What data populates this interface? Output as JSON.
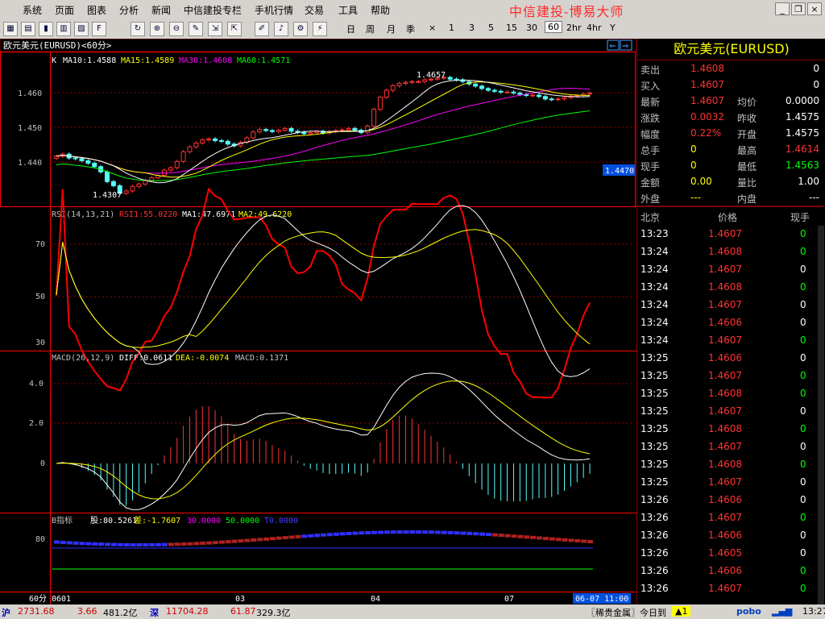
{
  "menu": [
    "系统",
    "页面",
    "图表",
    "分析",
    "新闻",
    "中信建投专栏",
    "手机行情",
    "交易",
    "工具",
    "帮助"
  ],
  "brand": "中信建投-博易大师",
  "periods": [
    "日",
    "周",
    "月",
    "季",
    "×",
    "1",
    "3",
    "5",
    "15",
    "30",
    "60",
    "2hr",
    "4hr",
    "Y"
  ],
  "selected_period": "60",
  "chart_title": "欧元美元(EURUSD)<60分>",
  "colors": {
    "up": "#ff3333",
    "down": "#54fcfc",
    "ma10": "#ffffff",
    "ma15": "#ffff00",
    "ma30": "#ff00ff",
    "ma60": "#00ff00",
    "grid": "#8b0000",
    "axis": "#ff0000"
  },
  "kpanel": {
    "label_k": "K",
    "ma10": "MA10:1.4588",
    "ma15": "MA15:1.4589",
    "ma30": "MA30:1.4608",
    "ma60": "MA60:1.4571",
    "ticks": [
      "1.460",
      "1.450",
      "1.440"
    ],
    "high_annot": "1.4657",
    "low_annot": "1.4307",
    "price_tag": "1.4470"
  },
  "rsi": {
    "label": "RSI(14,13,21)",
    "rsi1": "RSI1:55.0220",
    "ma1": "MA1:47.6971",
    "ma2": "MA2:49.6220",
    "ticks": [
      "70",
      "50",
      "30"
    ]
  },
  "macd": {
    "label": "MACD(26,12,9)",
    "diff": "DIFF:0.0611",
    "dea": "DEA:-0.0074",
    "macd": "MACD:0.1371",
    "ticks": [
      "4.0",
      "2.0",
      "0"
    ]
  },
  "b": {
    "label": "B指标",
    "gu": "股:80.5261",
    "cha": "差:-1.7607",
    "v30": "30.0000",
    "v50": "50.0000",
    "t0": "T0.0000",
    "ticks": [
      "80"
    ]
  },
  "xaxis": {
    "period_label": "60分",
    "labels": [
      "0601",
      "03",
      "04",
      "07"
    ],
    "cursor": "06-07 11:00"
  },
  "chart_data": {
    "type": "line",
    "x": [
      "0601",
      "03",
      "04",
      "07"
    ],
    "series": [
      {
        "name": "MA10",
        "values": [
          1.4588
        ]
      },
      {
        "name": "MA15",
        "values": [
          1.4589
        ]
      },
      {
        "name": "MA30",
        "values": [
          1.4608
        ]
      },
      {
        "name": "MA60",
        "values": [
          1.4571
        ]
      }
    ],
    "ylim": [
      1.429,
      1.468
    ],
    "candles_close": [
      1.4425,
      1.4431,
      1.442,
      1.4418,
      1.4412,
      1.4405,
      1.4395,
      1.438,
      1.4352,
      1.434,
      1.4318,
      1.4325,
      1.4338,
      1.4345,
      1.4356,
      1.4363,
      1.437,
      1.4385,
      1.4392,
      1.441,
      1.4438,
      1.4452,
      1.4463,
      1.4472,
      1.4475,
      1.447,
      1.4468,
      1.446,
      1.4455,
      1.4465,
      1.4478,
      1.4495,
      1.4502,
      1.4499,
      1.4496,
      1.45,
      1.4505,
      1.4497,
      1.4494,
      1.449,
      1.4493,
      1.4497,
      1.4492,
      1.4496,
      1.4499,
      1.4501,
      1.4505,
      1.45,
      1.4493,
      1.4512,
      1.456,
      1.4595,
      1.4615,
      1.4628,
      1.4635,
      1.4638,
      1.464,
      1.464,
      1.4645,
      1.4647,
      1.465,
      1.4652,
      1.4647,
      1.4645,
      1.464,
      1.4633,
      1.4627,
      1.462,
      1.4615,
      1.4612,
      1.461,
      1.461,
      1.4607,
      1.4603,
      1.46,
      1.4601,
      1.4597,
      1.459,
      1.4588,
      1.459,
      1.4594,
      1.4598,
      1.46,
      1.4604,
      1.4607
    ]
  },
  "quote": {
    "title": "欧元美元(EURUSD)",
    "rows": [
      {
        "l1": "卖出",
        "v1": "1.4608",
        "l2": "",
        "v2": "0"
      },
      {
        "l1": "买入",
        "v1": "1.4607",
        "l2": "",
        "v2": "0"
      },
      {
        "l1": "最新",
        "v1": "1.4607",
        "l2": "均价",
        "v2": "0.0000"
      },
      {
        "l1": "涨跌",
        "v1": "0.0032",
        "l2": "昨收",
        "v2": "1.4575"
      },
      {
        "l1": "幅度",
        "v1": "0.22%",
        "l2": "开盘",
        "v2": "1.4575"
      },
      {
        "l1": "总手",
        "v1": "0",
        "l2": "最高",
        "v2": "1.4614"
      },
      {
        "l1": "现手",
        "v1": "0",
        "l2": "最低",
        "v2": "1.4563"
      },
      {
        "l1": "金额",
        "v1": "0.00",
        "l2": "量比",
        "v2": "1.00"
      },
      {
        "l1": "外盘",
        "v1": "---",
        "l2": "内盘",
        "v2": "---"
      }
    ],
    "tick_header": [
      "北京",
      "价格",
      "现手"
    ],
    "ticks": [
      {
        "t": "13:23",
        "p": "1.4607",
        "v": "0",
        "c": "up"
      },
      {
        "t": "13:24",
        "p": "1.4608",
        "v": "0",
        "c": "up"
      },
      {
        "t": "13:24",
        "p": "1.4607",
        "v": "0",
        "c": "dn"
      },
      {
        "t": "13:24",
        "p": "1.4608",
        "v": "0",
        "c": "up"
      },
      {
        "t": "13:24",
        "p": "1.4607",
        "v": "0",
        "c": "dn"
      },
      {
        "t": "13:24",
        "p": "1.4606",
        "v": "0",
        "c": "dn"
      },
      {
        "t": "13:24",
        "p": "1.4607",
        "v": "0",
        "c": "up"
      },
      {
        "t": "13:25",
        "p": "1.4606",
        "v": "0",
        "c": "dn"
      },
      {
        "t": "13:25",
        "p": "1.4607",
        "v": "0",
        "c": "up"
      },
      {
        "t": "13:25",
        "p": "1.4608",
        "v": "0",
        "c": "up"
      },
      {
        "t": "13:25",
        "p": "1.4607",
        "v": "0",
        "c": "dn"
      },
      {
        "t": "13:25",
        "p": "1.4608",
        "v": "0",
        "c": "up"
      },
      {
        "t": "13:25",
        "p": "1.4607",
        "v": "0",
        "c": "dn"
      },
      {
        "t": "13:25",
        "p": "1.4608",
        "v": "0",
        "c": "up"
      },
      {
        "t": "13:25",
        "p": "1.4607",
        "v": "0",
        "c": "dn"
      },
      {
        "t": "13:26",
        "p": "1.4606",
        "v": "0",
        "c": "dn"
      },
      {
        "t": "13:26",
        "p": "1.4607",
        "v": "0",
        "c": "up"
      },
      {
        "t": "13:26",
        "p": "1.4606",
        "v": "0",
        "c": "dn"
      },
      {
        "t": "13:26",
        "p": "1.4605",
        "v": "0",
        "c": "dn"
      },
      {
        "t": "13:26",
        "p": "1.4606",
        "v": "0",
        "c": "up"
      },
      {
        "t": "13:26",
        "p": "1.4607",
        "v": "0",
        "c": "up"
      }
    ]
  },
  "status": {
    "sh": "沪",
    "sh_val": "2731.68",
    "sh_chg": "3.66",
    "sh_amt": "481.2亿",
    "sz": "深",
    "sz_val": "11704.28",
    "sz_chg": "61.87",
    "sz_amt": "329.3亿",
    "news": "〖稀贵金属〗今日到",
    "alert": "▲1",
    "logo": "pobo",
    "time": "13:27"
  }
}
